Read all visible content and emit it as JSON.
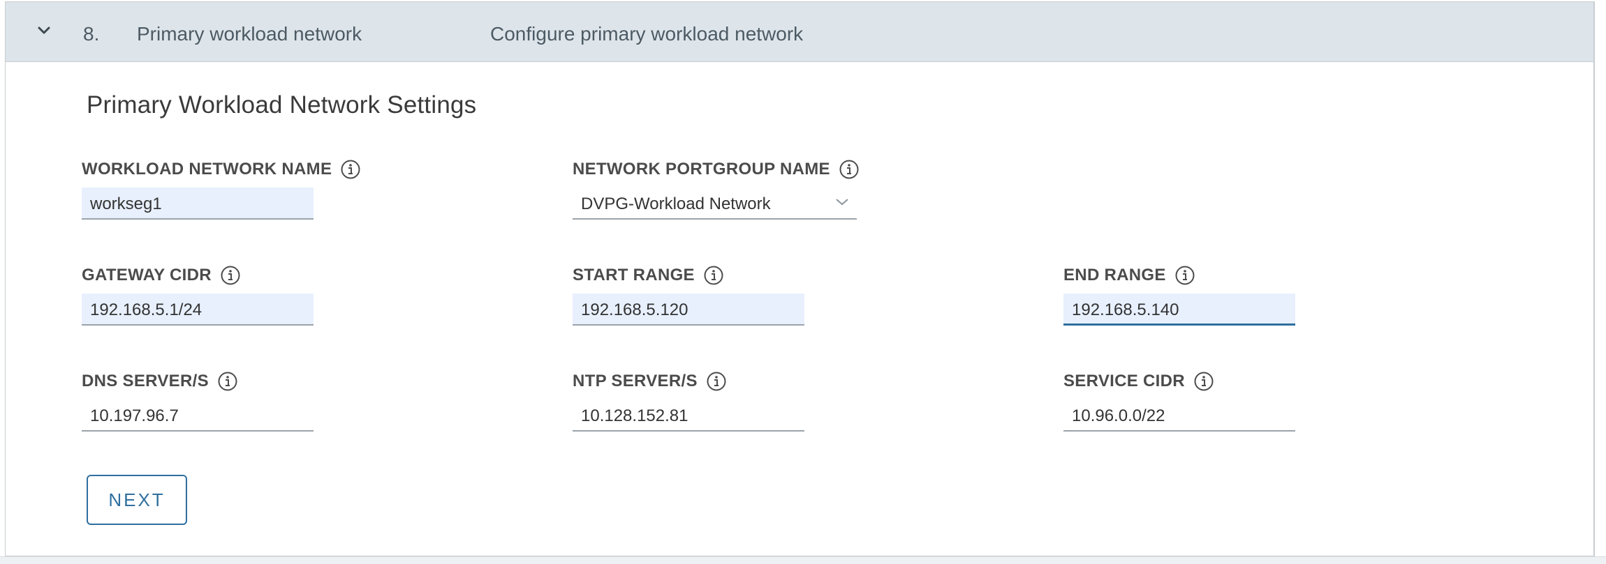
{
  "step": {
    "number": "8.",
    "title": "Primary workload network",
    "description": "Configure primary workload network"
  },
  "section_title": "Primary Workload Network Settings",
  "fields": {
    "workload_network_name": {
      "label": "WORKLOAD NETWORK NAME",
      "value": "workseg1"
    },
    "network_portgroup_name": {
      "label": "NETWORK PORTGROUP NAME",
      "value": "DVPG-Workload Network"
    },
    "gateway_cidr": {
      "label": "GATEWAY CIDR",
      "value": "192.168.5.1/24"
    },
    "start_range": {
      "label": "START RANGE",
      "value": "192.168.5.120"
    },
    "end_range": {
      "label": "END RANGE",
      "value": "192.168.5.140"
    },
    "dns_servers": {
      "label": "DNS SERVER/S",
      "value": "10.197.96.7"
    },
    "ntp_servers": {
      "label": "NTP SERVER/S",
      "value": "10.128.152.81"
    },
    "service_cidr": {
      "label": "SERVICE CIDR",
      "value": "10.96.0.0/22"
    }
  },
  "next_label": "NEXT",
  "icons": {
    "collapse": "chevron-down-icon",
    "info": "info-circle-icon",
    "dropdown": "caret-down-icon"
  },
  "colors": {
    "header_bg": "#dde5eb",
    "autofill_bg": "#e8f0fe",
    "accent": "#2f6f9f",
    "border": "#c7cdd2"
  }
}
